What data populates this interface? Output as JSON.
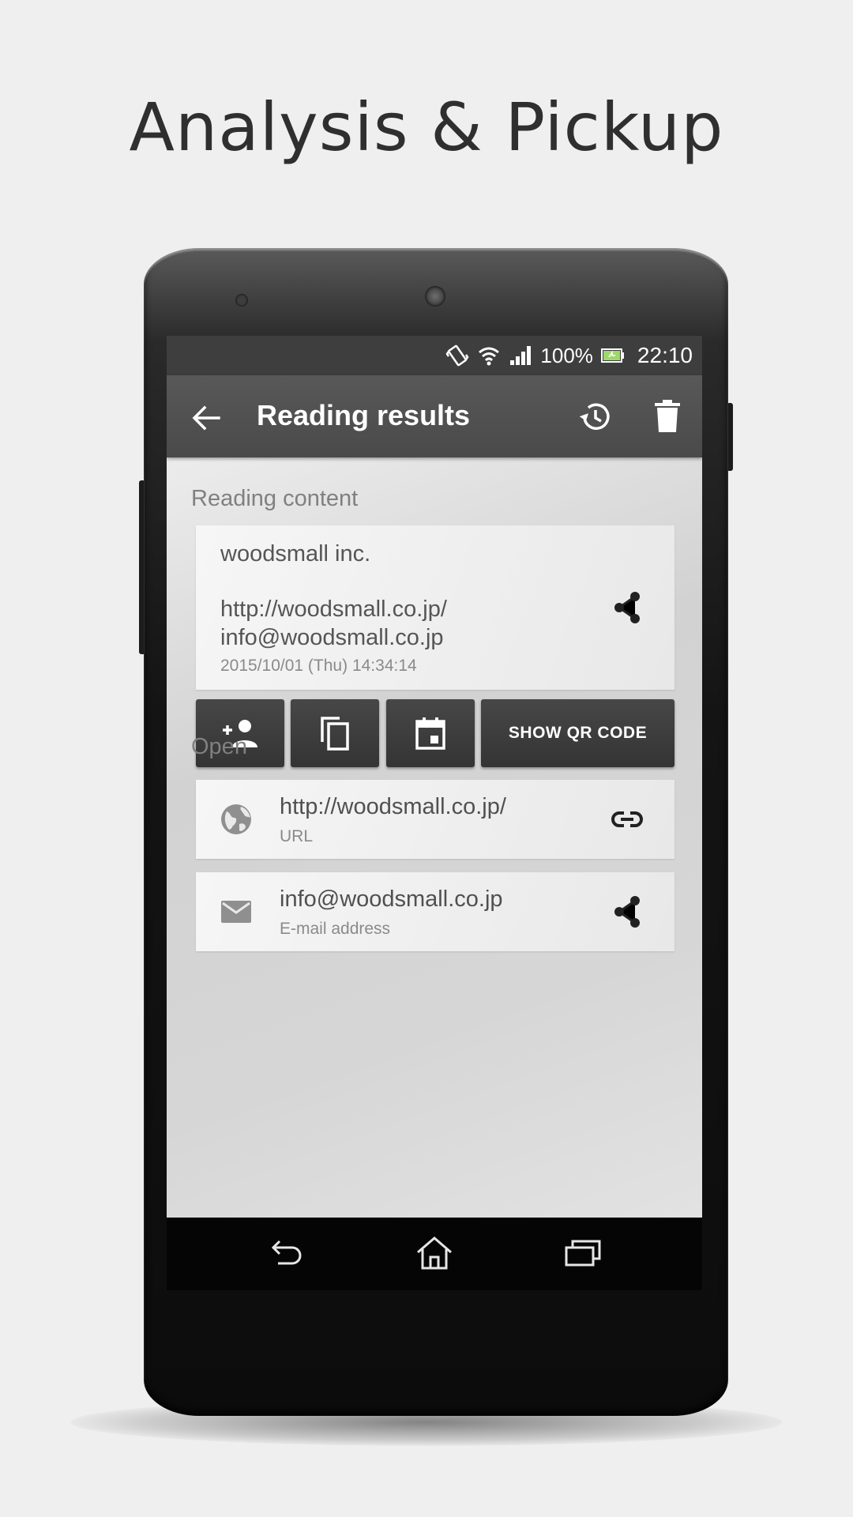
{
  "promo": {
    "headline": "Analysis & Pickup"
  },
  "status_bar": {
    "battery": "100%",
    "time": "22:10",
    "icons": [
      "vibrate-icon",
      "wifi-icon",
      "signal-icon",
      "battery-icon"
    ]
  },
  "app_bar": {
    "title": "Reading results",
    "icons": [
      "back-arrow-icon",
      "history-icon",
      "delete-icon"
    ]
  },
  "reading": {
    "section_label": "Reading content",
    "lines": [
      "woodsmall inc.",
      "http://woodsmall.co.jp/",
      "info@woodsmall.co.jp"
    ],
    "timestamp": "2015/10/01 (Thu) 14:34:14"
  },
  "actions": {
    "icons": [
      "add-contact-icon",
      "copy-icon",
      "calendar-icon"
    ],
    "show_qr_label": "SHOW QR CODE"
  },
  "open": {
    "section_label": "Open",
    "items": [
      {
        "value": "http://woodsmall.co.jp/",
        "type": "URL",
        "icon": "globe-icon",
        "action_icon": "link-icon"
      },
      {
        "value": "info@woodsmall.co.jp",
        "type": "E-mail address",
        "icon": "mail-icon",
        "action_icon": "share-icon"
      }
    ]
  },
  "nav_bar": {
    "icons": [
      "back-nav-icon",
      "home-nav-icon",
      "recents-nav-icon"
    ]
  },
  "colors": {
    "background": "#efefef",
    "app_bar": "#4f4f4f",
    "status_bar": "#3e3e3e",
    "action_button": "#3c3c3c"
  }
}
